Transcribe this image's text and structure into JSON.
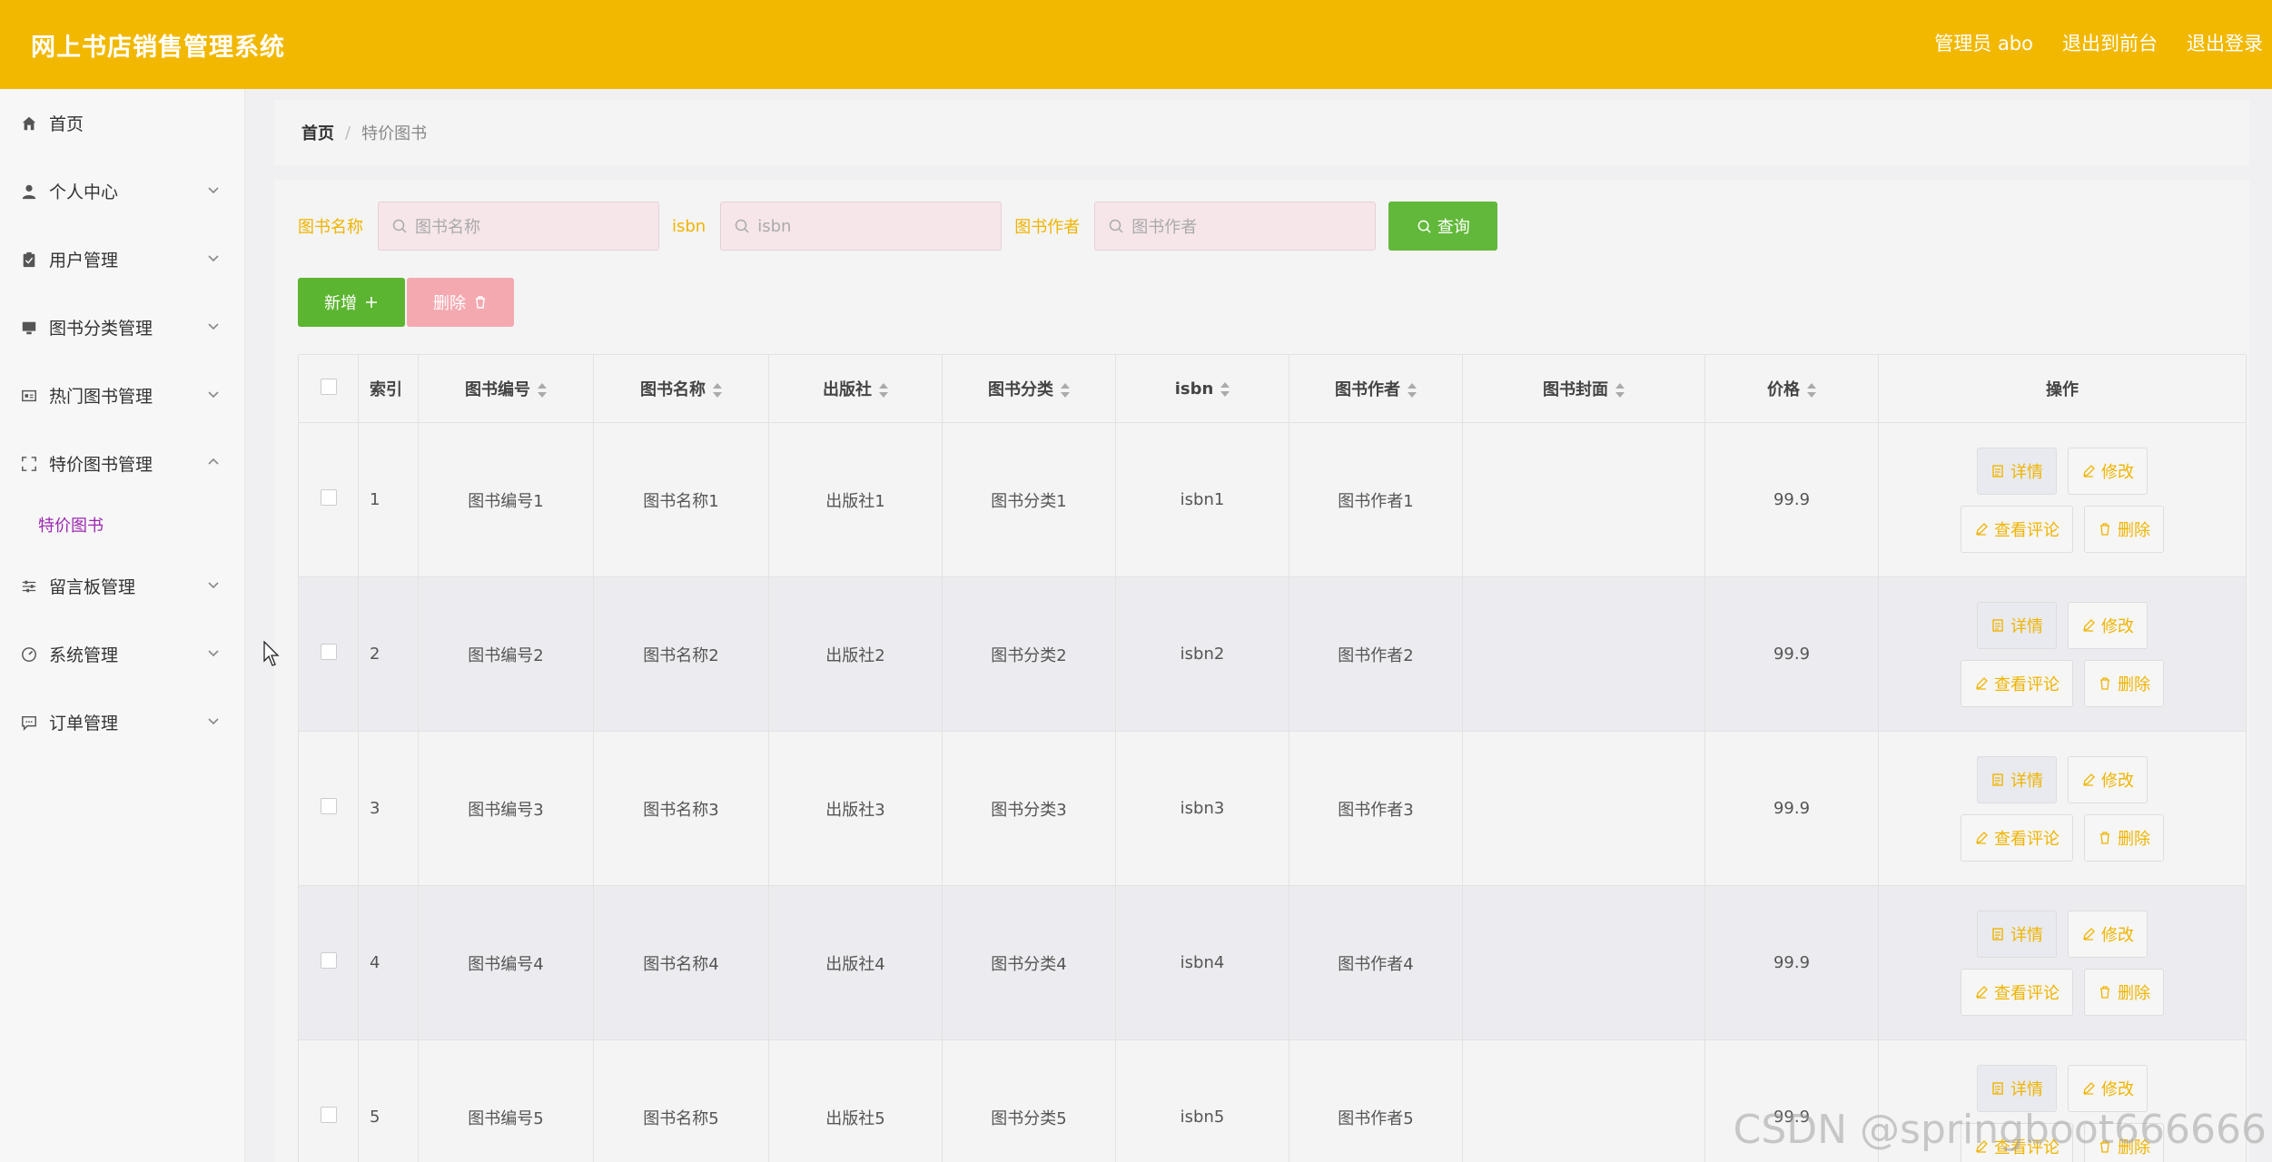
{
  "header": {
    "title": "网上书店销售管理系统",
    "admin": "管理员 abo",
    "to_front": "退出到前台",
    "logout": "退出登录"
  },
  "sidebar": {
    "items": [
      {
        "label": "首页",
        "icon": "home-icon"
      },
      {
        "label": "个人中心",
        "icon": "user-icon"
      },
      {
        "label": "用户管理",
        "icon": "clipboard-icon"
      },
      {
        "label": "图书分类管理",
        "icon": "monitor-icon"
      },
      {
        "label": "热门图书管理",
        "icon": "card-icon"
      },
      {
        "label": "特价图书管理",
        "icon": "frame-icon"
      },
      {
        "label": "留言板管理",
        "icon": "sliders-icon"
      },
      {
        "label": "系统管理",
        "icon": "gauge-icon"
      },
      {
        "label": "订单管理",
        "icon": "chat-icon"
      }
    ],
    "sub_item": "特价图书"
  },
  "breadcrumb": {
    "home": "首页",
    "sep": "/",
    "current": "特价图书"
  },
  "search": {
    "name_label": "图书名称",
    "name_placeholder": "图书名称",
    "isbn_label": "isbn",
    "isbn_placeholder": "isbn",
    "author_label": "图书作者",
    "author_placeholder": "图书作者",
    "query_label": "查询"
  },
  "actions": {
    "add": "新增",
    "delete": "删除"
  },
  "table": {
    "headers": [
      "索引",
      "图书编号",
      "图书名称",
      "出版社",
      "图书分类",
      "isbn",
      "图书作者",
      "图书封面",
      "价格",
      "操作"
    ],
    "rows": [
      {
        "index": "1",
        "code": "图书编号1",
        "name": "图书名称1",
        "publisher": "出版社1",
        "category": "图书分类1",
        "isbn": "isbn1",
        "author": "图书作者1",
        "price": "99.9"
      },
      {
        "index": "2",
        "code": "图书编号2",
        "name": "图书名称2",
        "publisher": "出版社2",
        "category": "图书分类2",
        "isbn": "isbn2",
        "author": "图书作者2",
        "price": "99.9"
      },
      {
        "index": "3",
        "code": "图书编号3",
        "name": "图书名称3",
        "publisher": "出版社3",
        "category": "图书分类3",
        "isbn": "isbn3",
        "author": "图书作者3",
        "price": "99.9"
      },
      {
        "index": "4",
        "code": "图书编号4",
        "name": "图书名称4",
        "publisher": "出版社4",
        "category": "图书分类4",
        "isbn": "isbn4",
        "author": "图书作者4",
        "price": "99.9"
      },
      {
        "index": "5",
        "code": "图书编号5",
        "name": "图书名称5",
        "publisher": "出版社5",
        "category": "图书分类5",
        "isbn": "isbn5",
        "author": "图书作者5",
        "price": "99.9"
      }
    ],
    "ops": {
      "detail": "详情",
      "edit": "修改",
      "comments": "查看评论",
      "delete": "删除"
    }
  },
  "watermark": "CSDN @springboot666666",
  "colors": {
    "header": "#f2b800",
    "accent": "#f0b400",
    "primary_green": "#5cb531",
    "danger_pink": "#f4a9b1",
    "active_submenu": "#9c27b0"
  }
}
